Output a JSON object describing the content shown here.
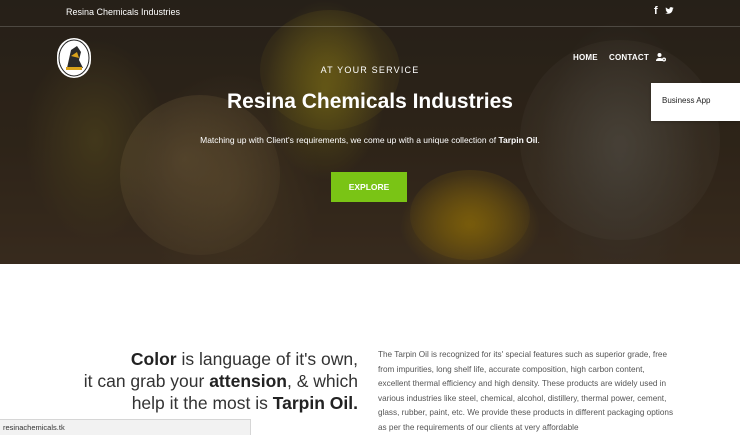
{
  "topbar": {
    "title": "Resina Chemicals Industries",
    "facebook_icon": "f",
    "twitter_icon": "twitter-icon"
  },
  "nav": {
    "items": [
      {
        "label": "HOME"
      },
      {
        "label": "CONTACT"
      }
    ],
    "user_icon": "user-cog-icon"
  },
  "dropdown": {
    "item": "Business App"
  },
  "hero": {
    "tagline": "AT YOUR SERVICE",
    "title": "Resina Chemicals Industries",
    "description_prefix": "Matching up with Client's requirements, we come up with a unique collection of ",
    "description_highlight": "Tarpin Oil",
    "description_suffix": ".",
    "button": "EXPLORE"
  },
  "quote": {
    "word1": "Color",
    "text1": " is language of it's own,",
    "text2": "it can grab your ",
    "word2": "attension",
    "text3": ", & which",
    "text4": "help it the most is ",
    "word3": "Tarpin Oil."
  },
  "body_text": "The Tarpin Oil is recognized for its' special features such as superior grade, free from impurities, long shelf life, accurate composition, high carbon content, excellent thermal efficiency and high density. These products are widely used in various industries like steel, chemical, alcohol, distillery, thermal power, cement, glass, rubber, paint, etc. We provide these products in different packaging options as per the requirements of our clients at very affordable",
  "status_bar": {
    "url": "resinachemicals.tk"
  },
  "colors": {
    "accent": "#7ac415",
    "hero_text": "#ffffff",
    "dropdown_bg": "#ffffff"
  }
}
